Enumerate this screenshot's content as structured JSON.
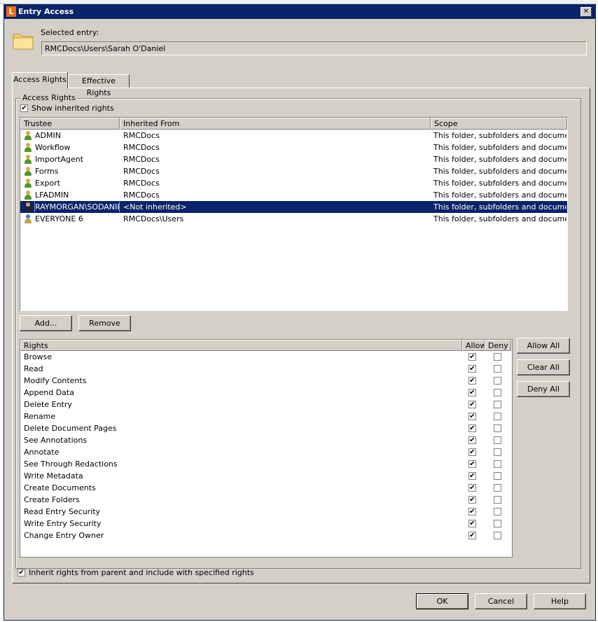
{
  "window": {
    "title": "Entry Access",
    "app_icon_letter": "L",
    "close_glyph": "✕"
  },
  "selected_entry": {
    "label": "Selected entry:",
    "value": "RMCDocs\\Users\\Sarah O'Daniel"
  },
  "tabs": [
    {
      "label": "Access Rights"
    },
    {
      "label": "Effective Rights"
    }
  ],
  "access_rights": {
    "group_label": "Access Rights",
    "show_inherited": {
      "label": "Show inherited rights",
      "checked": true
    },
    "columns": [
      "Trustee",
      "Inherited From",
      "Scope"
    ],
    "trustees": [
      {
        "name": "ADMIN",
        "inherited_from": "RMCDocs",
        "scope": "This folder, subfolders and documents",
        "icon": "user-icon"
      },
      {
        "name": "Workflow",
        "inherited_from": "RMCDocs",
        "scope": "This folder, subfolders and documents",
        "icon": "user-icon"
      },
      {
        "name": "ImportAgent",
        "inherited_from": "RMCDocs",
        "scope": "This folder, subfolders and documents",
        "icon": "user-icon"
      },
      {
        "name": "Forms",
        "inherited_from": "RMCDocs",
        "scope": "This folder, subfolders and documents",
        "icon": "user-icon"
      },
      {
        "name": "Export",
        "inherited_from": "RMCDocs",
        "scope": "This folder, subfolders and documents",
        "icon": "user-icon"
      },
      {
        "name": "LFADMIN",
        "inherited_from": "RMCDocs",
        "scope": "This folder, subfolders and documents",
        "icon": "user-icon"
      },
      {
        "name": "RAYMORGAN\\SODANIEL",
        "inherited_from": "<Not inherited>",
        "scope": "This folder, subfolders and documents",
        "icon": "domain-user-icon",
        "selected": true
      },
      {
        "name": "EVERYONE 6",
        "inherited_from": "RMCDocs\\Users",
        "scope": "This folder, subfolders and documents",
        "icon": "group-icon"
      }
    ],
    "add_label": "Add...",
    "remove_label": "Remove"
  },
  "rights": {
    "columns": [
      "Rights",
      "Allow",
      "Deny"
    ],
    "items": [
      {
        "name": "Browse",
        "allow": true,
        "deny": false
      },
      {
        "name": "Read",
        "allow": true,
        "deny": false
      },
      {
        "name": "Modify Contents",
        "allow": true,
        "deny": false
      },
      {
        "name": "Append Data",
        "allow": true,
        "deny": false
      },
      {
        "name": "Delete Entry",
        "allow": true,
        "deny": false
      },
      {
        "name": "Rename",
        "allow": true,
        "deny": false
      },
      {
        "name": "Delete Document Pages",
        "allow": true,
        "deny": false
      },
      {
        "name": "See Annotations",
        "allow": true,
        "deny": false
      },
      {
        "name": "Annotate",
        "allow": true,
        "deny": false
      },
      {
        "name": "See Through Redactions",
        "allow": true,
        "deny": false
      },
      {
        "name": "Write Metadata",
        "allow": true,
        "deny": false
      },
      {
        "name": "Create Documents",
        "allow": true,
        "deny": false
      },
      {
        "name": "Create Folders",
        "allow": true,
        "deny": false
      },
      {
        "name": "Read Entry Security",
        "allow": true,
        "deny": false
      },
      {
        "name": "Write Entry Security",
        "allow": true,
        "deny": false
      },
      {
        "name": "Change Entry Owner",
        "allow": true,
        "deny": false
      }
    ],
    "allow_all_label": "Allow All",
    "clear_all_label": "Clear All",
    "deny_all_label": "Deny All"
  },
  "inherit": {
    "label": "Inherit rights from parent and include with specified rights",
    "checked": true
  },
  "footer": {
    "ok_label": "OK",
    "cancel_label": "Cancel",
    "help_label": "Help"
  },
  "colors": {
    "titlebar": "#0a246a",
    "dialog_bg": "#d4d0c8",
    "selection": "#0a246a",
    "app_icon": "#f16b0e"
  }
}
